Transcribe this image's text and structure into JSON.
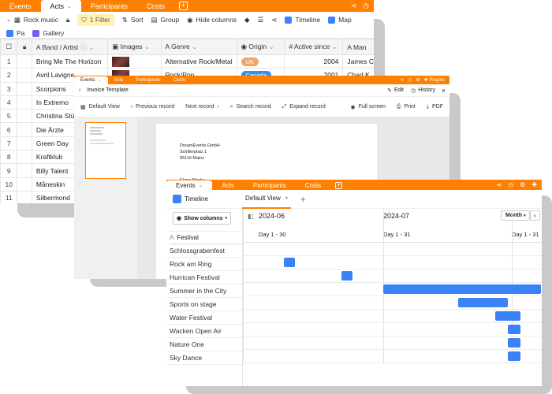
{
  "win1": {
    "tabs": [
      "Events",
      "Acts",
      "Participants",
      "Costs"
    ],
    "active_tab": "Acts",
    "toolbar": {
      "view_name": "Rock music",
      "filter": "1 Filter",
      "sort": "Sort",
      "group": "Group",
      "hide_columns": "Hide columns",
      "timeline": "Timeline",
      "map": "Map",
      "page": "Pa",
      "gallery": "Gallery"
    },
    "columns": [
      "Band / Artist",
      "Images",
      "Genre",
      "Origin",
      "Active since",
      "Man"
    ],
    "rows": [
      {
        "num": "1",
        "band": "Bring Me The Horizon",
        "genre": "Alternative Rock/Metal",
        "origin": "UK",
        "origin_color": "#f4a468",
        "active": "2004",
        "man": "James C"
      },
      {
        "num": "2",
        "band": "Avril Lavigne",
        "genre": "Rock/Pop",
        "origin": "Canada",
        "origin_color": "#3b8fe8",
        "active": "2001",
        "man": "Chad K"
      },
      {
        "num": "3",
        "band": "Scorpions",
        "genre": "",
        "origin": "",
        "origin_color": "",
        "active": "",
        "man": ""
      },
      {
        "num": "4",
        "band": "In Extremo",
        "genre": "",
        "origin": "",
        "origin_color": "",
        "active": "",
        "man": ""
      },
      {
        "num": "5",
        "band": "Christina Stür",
        "genre": "",
        "origin": "",
        "origin_color": "",
        "active": "",
        "man": ""
      },
      {
        "num": "6",
        "band": "Die Ärzte",
        "genre": "",
        "origin": "",
        "origin_color": "",
        "active": "",
        "man": ""
      },
      {
        "num": "7",
        "band": "Green Day",
        "genre": "",
        "origin": "",
        "origin_color": "",
        "active": "",
        "man": ""
      },
      {
        "num": "8",
        "band": "Kraftklub",
        "genre": "",
        "origin": "",
        "origin_color": "",
        "active": "",
        "man": ""
      },
      {
        "num": "9",
        "band": "Billy Talent",
        "genre": "",
        "origin": "",
        "origin_color": "",
        "active": "",
        "man": ""
      },
      {
        "num": "10",
        "band": "Måneskin",
        "genre": "",
        "origin": "",
        "origin_color": "",
        "active": "",
        "man": ""
      },
      {
        "num": "11",
        "band": "Silbermond",
        "genre": "",
        "origin": "",
        "origin_color": "",
        "active": "",
        "man": ""
      }
    ]
  },
  "win2": {
    "tabs": [
      "Events",
      "Acts",
      "Participants",
      "Costs"
    ],
    "active_tab": "Events",
    "plugins": "Plugins",
    "title": "Invoice Template",
    "edit": "Edit",
    "history": "History",
    "toolbar": {
      "default_view": "Default View",
      "previous": "Previous record",
      "next": "Next record",
      "search": "Search record",
      "expand": "Expand record",
      "fullscreen": "Full screen",
      "print": "Print",
      "pdf": "PDF"
    },
    "doc": {
      "company": "DreamEvents GmbH",
      "street": "Schillerplatz 1",
      "city": "55116 Mainz",
      "recipient": "Elena Meske"
    }
  },
  "win3": {
    "tabs": [
      "Events",
      "Acts",
      "Participants",
      "Costs"
    ],
    "active_tab": "Events",
    "view_type": "Timeline",
    "default_view": "Default View",
    "show_columns": "Show columns",
    "column_header": "Festival",
    "scale": "Month",
    "months": [
      "2024-06",
      "2024-07"
    ],
    "day_ranges": [
      "Day 1 - 30",
      "Day 1 - 31",
      "Day 1 - 31"
    ]
  },
  "chart_data": {
    "type": "gantt",
    "categories": [
      "Schlossgrabenfest",
      "Rock am Ring",
      "Hurrican Festival",
      "Summer in the City",
      "Sports on stage",
      "Water Festival",
      "Wacken Open Air",
      "Nature One",
      "Sky Dance"
    ],
    "bar_color": "#3b82f6",
    "bars": [
      {
        "label": "Rock am Ring",
        "start": "2024-06-07",
        "end": "2024-06-09"
      },
      {
        "label": "Hurrican Festival",
        "start": "2024-06-21",
        "end": "2024-06-23"
      },
      {
        "label": "Summer in the City",
        "start": "2024-07-01",
        "end": "2024-08-08"
      },
      {
        "label": "Sports on stage",
        "start": "2024-07-19",
        "end": "2024-07-31"
      },
      {
        "label": "Water Festival",
        "start": "2024-07-28",
        "end": "2024-08-03"
      },
      {
        "label": "Wacken Open Air",
        "start": "2024-07-31",
        "end": "2024-08-03"
      },
      {
        "label": "Nature One",
        "start": "2024-07-31",
        "end": "2024-08-03"
      },
      {
        "label": "Sky Dance",
        "start": "2024-07-31",
        "end": "2024-08-03"
      }
    ]
  }
}
